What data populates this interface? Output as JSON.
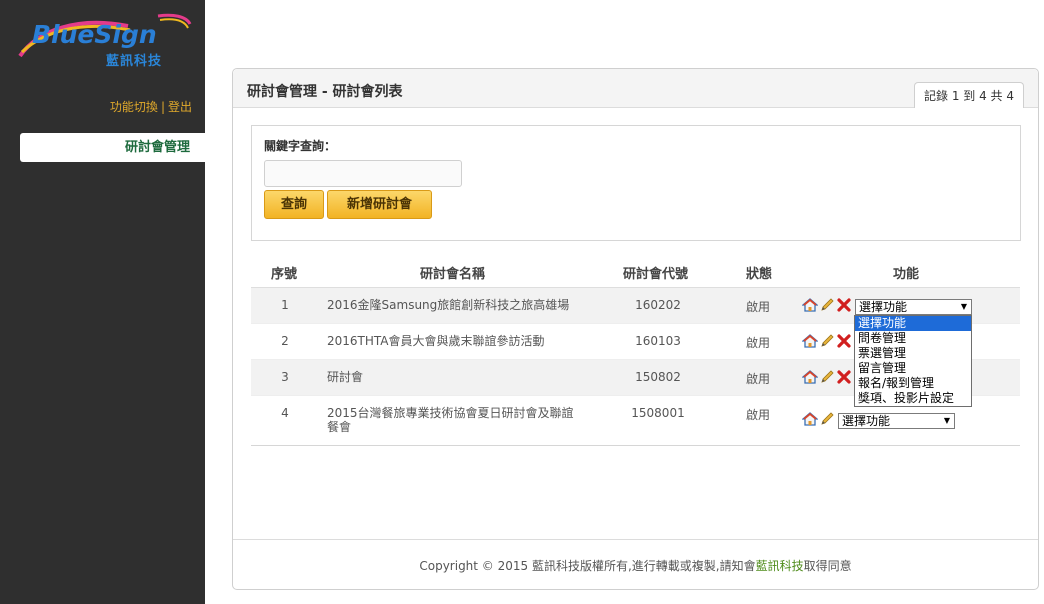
{
  "logo": {
    "name": "BlueSign",
    "subtitle": "藍訊科技"
  },
  "sidebar": {
    "links": {
      "switch_label": "功能切換",
      "separator": "|",
      "logout_label": "登出"
    },
    "menu_item": "研討會管理"
  },
  "panel": {
    "title": "研討會管理 - 研討會列表",
    "record_info": "記錄 1 到 4 共 4"
  },
  "search": {
    "label": "關鍵字查詢：",
    "value": "",
    "query_button": "查詢",
    "add_button": "新增研討會"
  },
  "table": {
    "headers": {
      "num": "序號",
      "name": "研討會名稱",
      "code": "研討會代號",
      "state": "狀態",
      "func": "功能"
    },
    "rows": [
      {
        "num": "1",
        "name": "2016金隆Samsung旅館創新科技之旅高雄場",
        "code": "160202",
        "state": "啟用",
        "select": "選擇功能"
      },
      {
        "num": "2",
        "name": "2016THTA會員大會與歲末聯誼參訪活動",
        "code": "160103",
        "state": "啟用",
        "select": "選擇功能"
      },
      {
        "num": "3",
        "name": "研討會",
        "code": "150802",
        "state": "啟用",
        "select": "選擇功能"
      },
      {
        "num": "4",
        "name": "2015台灣餐旅專業技術協會夏日研討會及聯誼餐會",
        "code": "1508001",
        "state": "啟用",
        "select": "選擇功能"
      }
    ]
  },
  "dropdown": {
    "options": [
      "選擇功能",
      "問卷管理",
      "票選管理",
      "留言管理",
      "報名/報到管理",
      "獎項、投影片設定"
    ],
    "selected_index": 0
  },
  "footer": {
    "text_before": "Copyright © 2015 藍訊科技版權所有,進行轉載或複製,請知會",
    "brand": "藍訊科技",
    "text_after": "取得同意"
  },
  "icons": [
    "home-icon",
    "edit-pencil-icon",
    "delete-x-icon"
  ],
  "colors": {
    "sidebar_bg": "#2f2f2f",
    "accent_orange": "#e0a92b",
    "button_yellow": "#f2b324",
    "menu_green": "#1d6a3d",
    "dropdown_highlight": "#1e6bd8"
  }
}
